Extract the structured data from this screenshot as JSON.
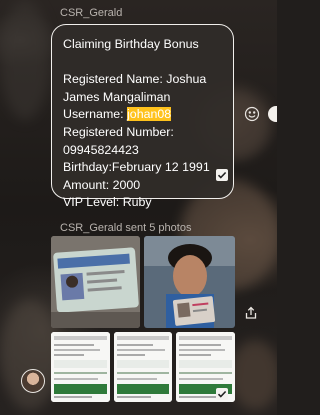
{
  "messages": [
    {
      "sender": "CSR_Gerald",
      "lines": [
        "Claiming Birthday Bonus",
        "",
        "Registered Name: Joshua",
        "James Mangaliman",
        "Registered Number:",
        "09945824423",
        "Birthday:February 12 1991",
        "Amount: 2000",
        "VIP Level: Ruby"
      ],
      "username_label": "Username: ",
      "username_value": "johan08"
    },
    {
      "sender": "CSR_Gerald sent 5 photos"
    }
  ],
  "icons": {
    "react": "smiley-icon",
    "more": "more-actions-icon",
    "share": "share-icon",
    "read_receipt": "checkmark-icon"
  },
  "colors": {
    "highlight": "#ffc21c",
    "bubble_border": "#f1efec"
  }
}
